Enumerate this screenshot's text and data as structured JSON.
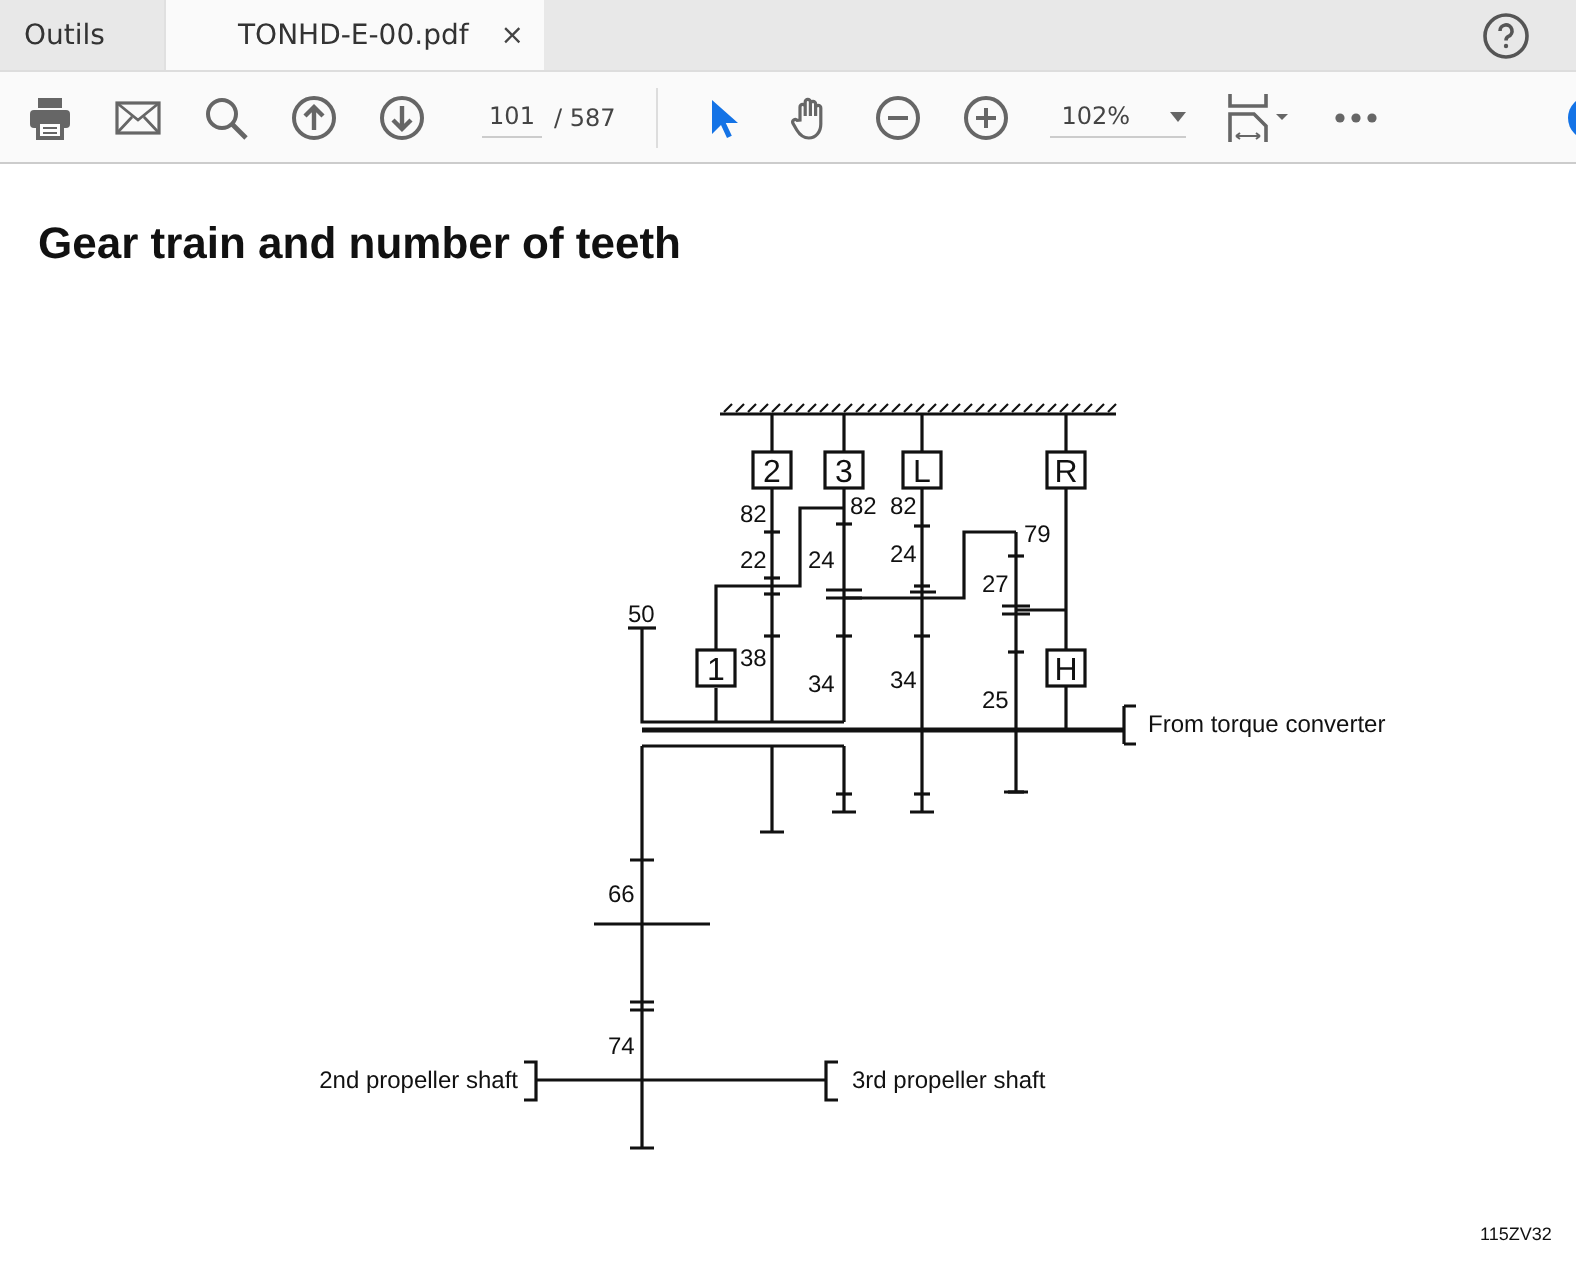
{
  "tabs": [
    {
      "label": "Outils",
      "selected": false
    },
    {
      "label": "TONHD-E-00.pdf",
      "selected": true,
      "close": "×"
    }
  ],
  "toolbar": {
    "page": "101",
    "page_total": "/ 587",
    "zoom": "102%",
    "tools": [
      {
        "kind": "select",
        "selected": true
      },
      {
        "kind": "hand",
        "selected": false
      }
    ]
  },
  "document": {
    "heading": "Gear train and number of teeth",
    "diagram": {
      "clutch_labels": [
        "2",
        "3",
        "L",
        "R",
        "1",
        "H"
      ],
      "teeth": [
        "82",
        "22",
        "82",
        "82",
        "24",
        "24",
        "79",
        "27",
        "50",
        "38",
        "34",
        "34",
        "25",
        "66",
        "74"
      ],
      "shaft_labels": [
        "From torque converter",
        "2nd propeller shaft",
        "3rd propeller shaft"
      ],
      "figure_code": "115ZV32"
    }
  }
}
